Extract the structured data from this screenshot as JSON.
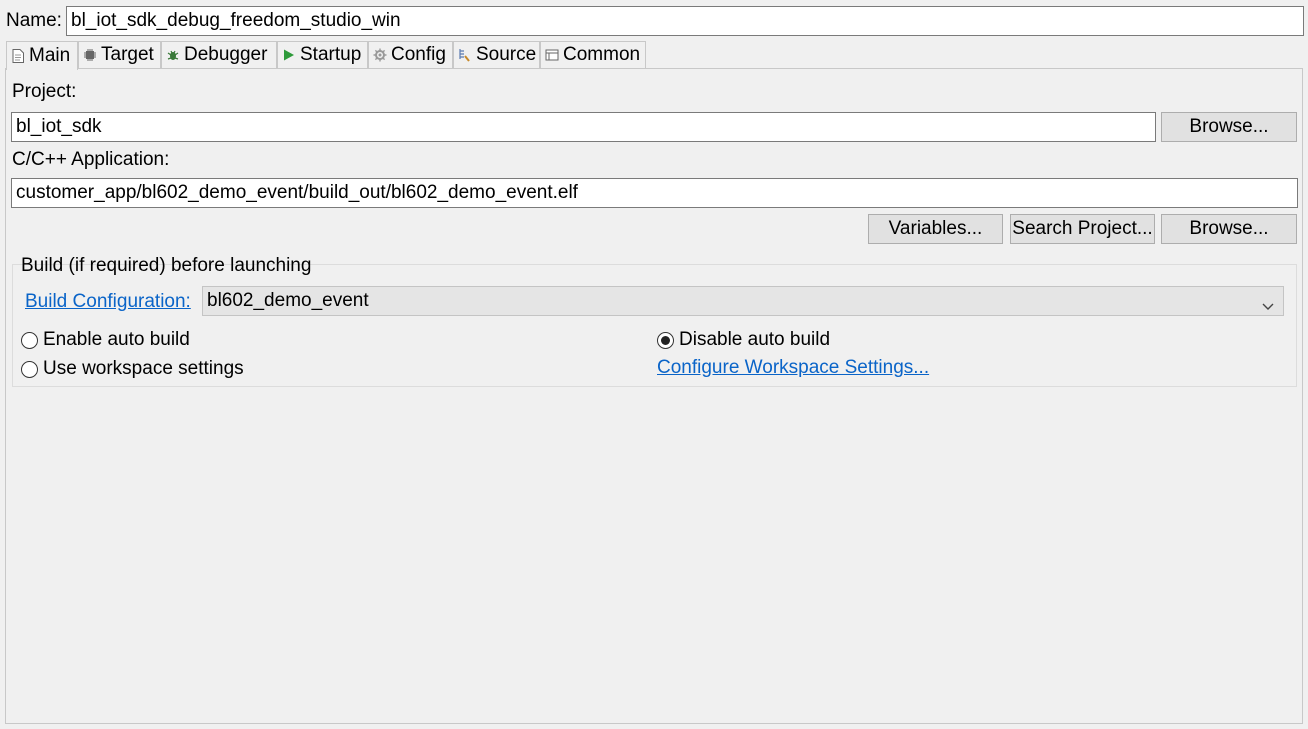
{
  "name": {
    "label": "Name:",
    "value": "bl_iot_sdk_debug_freedom_studio_win"
  },
  "tabs": [
    {
      "label": "Main",
      "icon": "document-icon",
      "active": true
    },
    {
      "label": "Target",
      "icon": "chip-icon",
      "active": false
    },
    {
      "label": "Debugger",
      "icon": "bug-icon",
      "active": false
    },
    {
      "label": "Startup",
      "icon": "play-icon",
      "active": false
    },
    {
      "label": "Config",
      "icon": "gear-icon",
      "active": false
    },
    {
      "label": "Source",
      "icon": "source-lookup-icon",
      "active": false
    },
    {
      "label": "Common",
      "icon": "common-icon",
      "active": false
    }
  ],
  "main": {
    "project_label": "Project:",
    "project_value": "bl_iot_sdk",
    "project_browse": "Browse...",
    "app_label": "C/C++ Application:",
    "app_value": "customer_app/bl602_demo_event/build_out/bl602_demo_event.elf",
    "variables_button": "Variables...",
    "search_project_button": "Search Project...",
    "app_browse": "Browse..."
  },
  "build": {
    "group_title": "Build (if required) before launching",
    "config_link": "Build Configuration:",
    "config_value": "bl602_demo_event",
    "enable_auto": "Enable auto build",
    "disable_auto": "Disable auto build",
    "use_workspace": "Use workspace settings",
    "configure_workspace_link": "Configure Workspace Settings...",
    "selected_option": "Disable auto build"
  },
  "colors": {
    "link": "#0a64c8",
    "background": "#f0f0f0",
    "startup_icon": "#2e9a3a"
  }
}
